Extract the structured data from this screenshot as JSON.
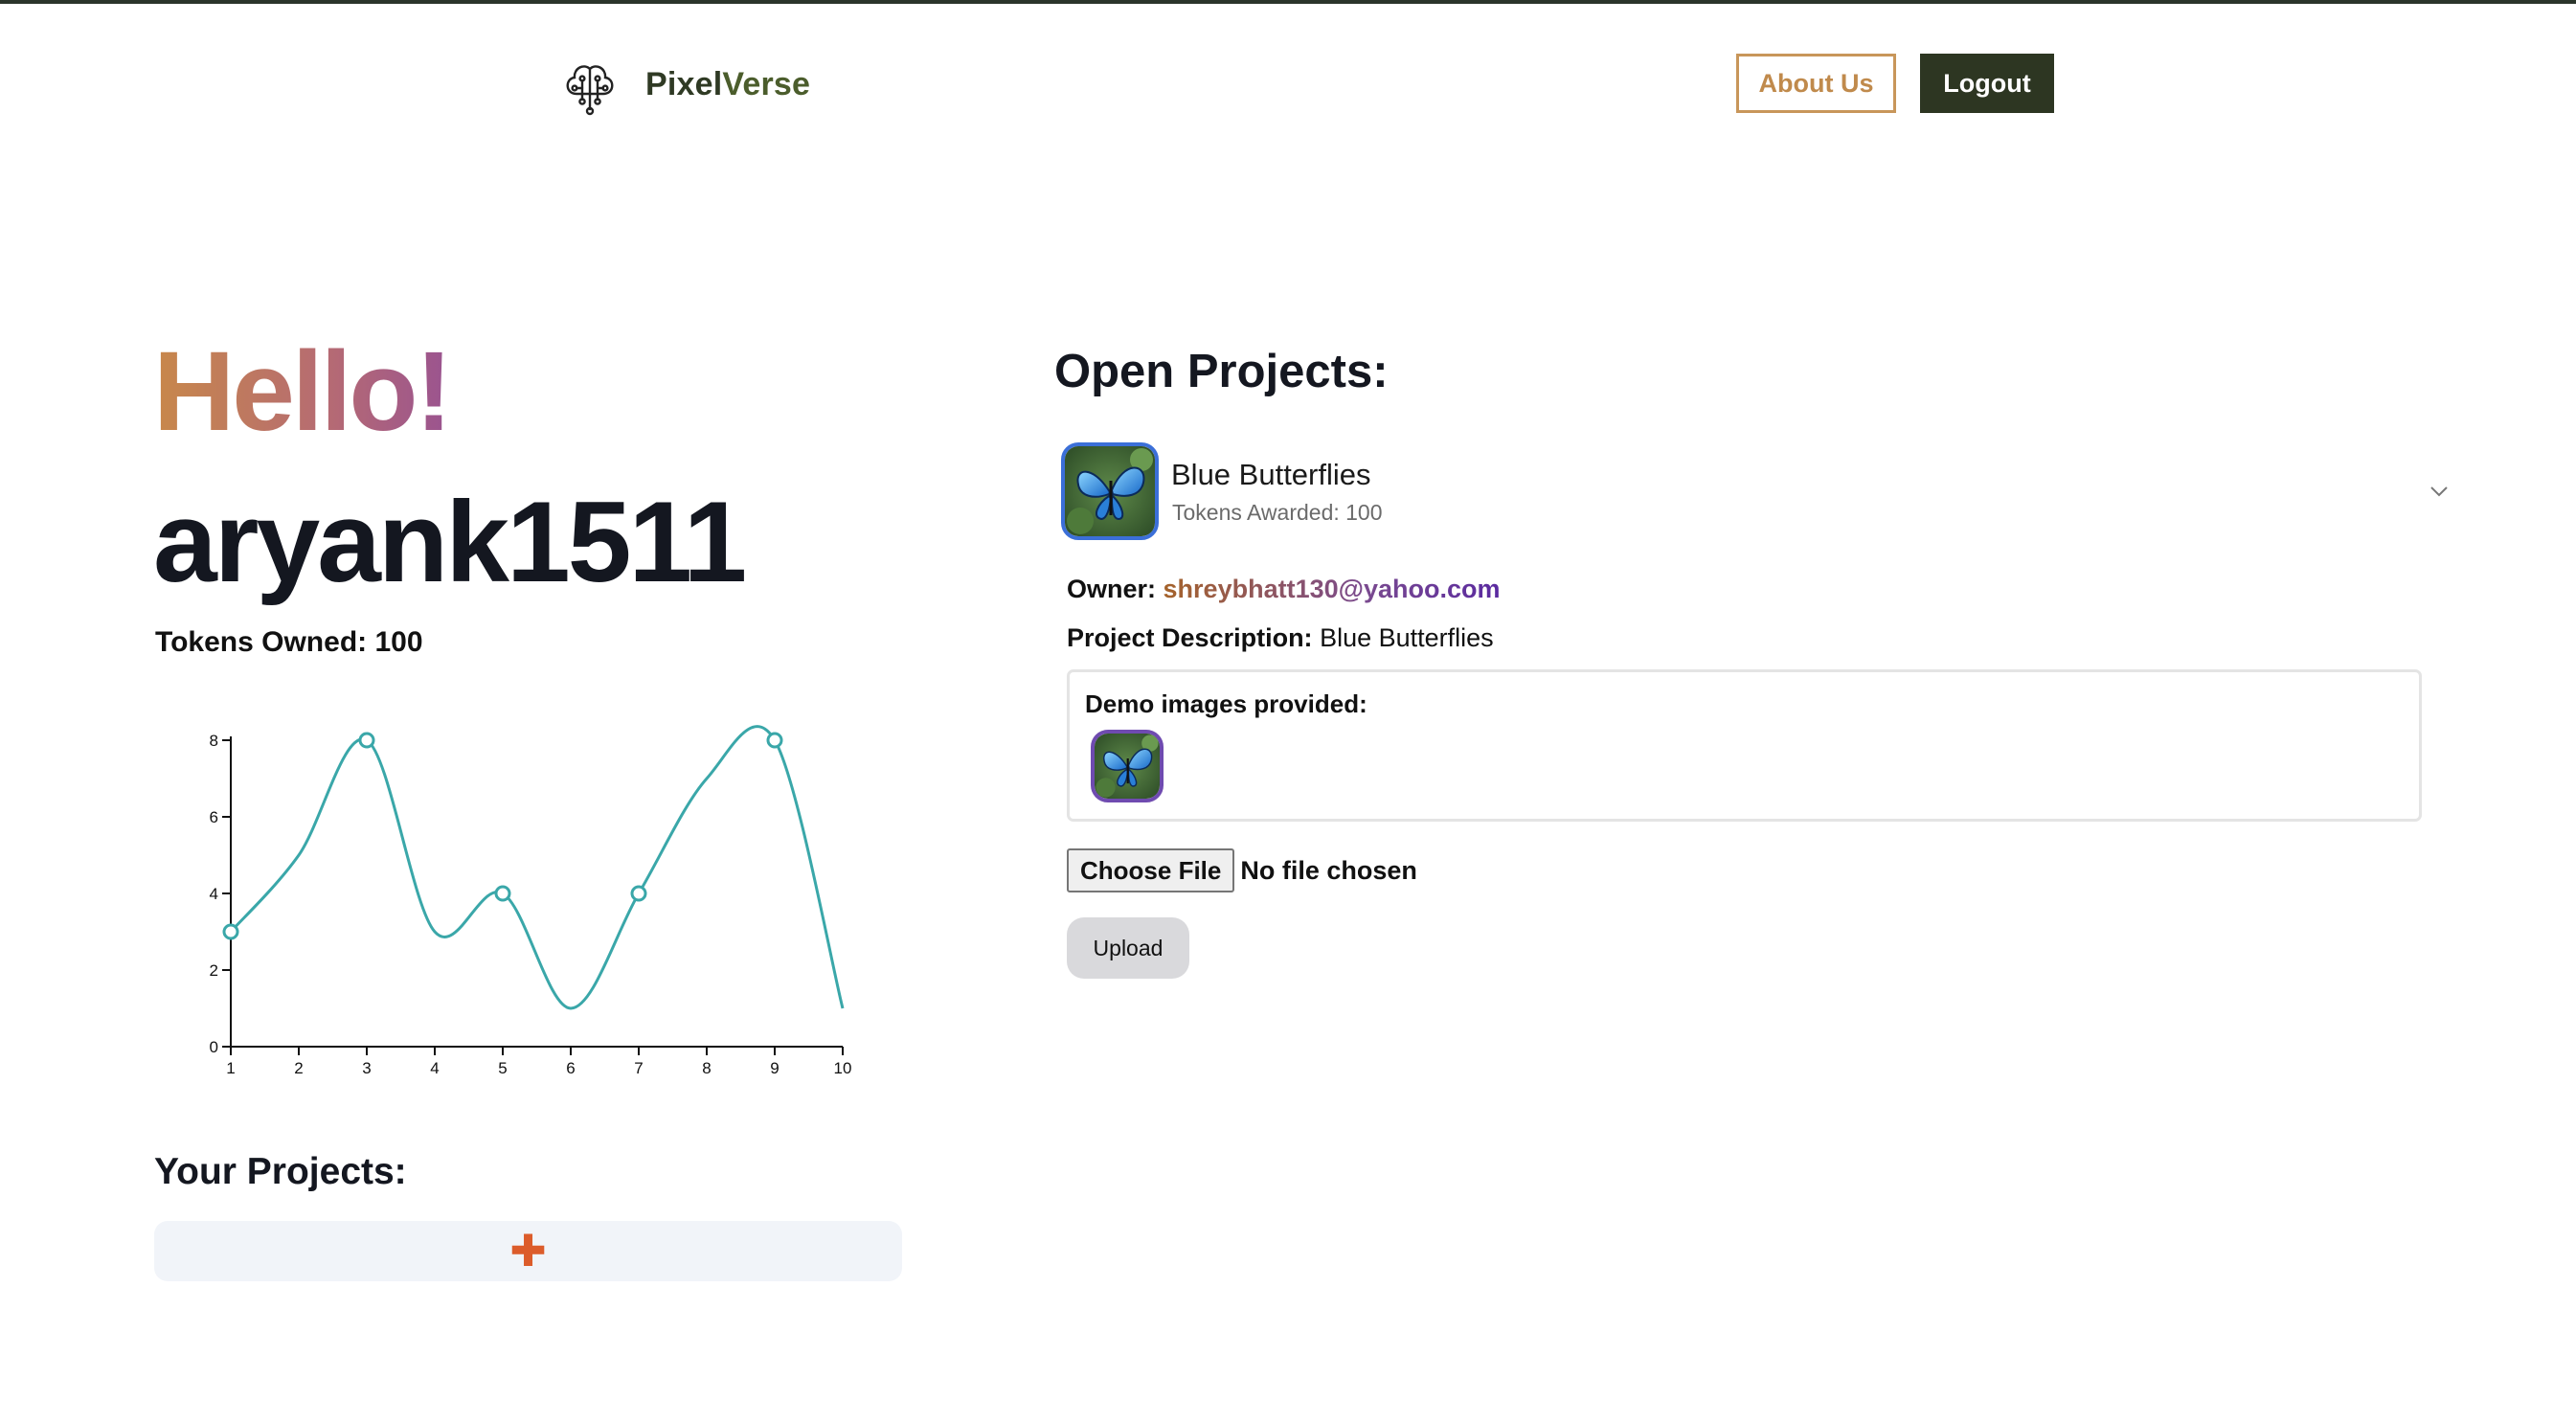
{
  "header": {
    "brand_part1": "Pixel",
    "brand_part2": "Verse",
    "logo_icon": "brain-circuit-icon",
    "about_label": "About Us",
    "logout_label": "Logout"
  },
  "profile": {
    "greeting": "Hello!",
    "username": "aryank1511",
    "tokens_owned": "Tokens Owned: 100"
  },
  "chart_data": {
    "type": "line",
    "x": [
      1,
      2,
      3,
      4,
      5,
      6,
      7,
      8,
      9,
      10
    ],
    "series": [
      {
        "values": [
          3,
          5,
          8,
          3,
          4,
          1,
          4,
          7,
          8,
          1
        ]
      }
    ],
    "marked_points": [
      1,
      3,
      5,
      7,
      9
    ],
    "xlim": [
      1,
      10
    ],
    "ylim": [
      0,
      8
    ],
    "y_ticks": [
      0,
      2,
      4,
      6,
      8
    ],
    "x_ticks": [
      1,
      2,
      3,
      4,
      5,
      6,
      7,
      8,
      9,
      10
    ],
    "line_color": "#3aa7a9",
    "curve": "smooth",
    "grid": false
  },
  "your_projects": {
    "title": "Your Projects:",
    "add_icon": "plus-icon",
    "add_symbol": "✚"
  },
  "open_projects": {
    "title": "Open Projects:",
    "project": {
      "name": "Blue Butterflies",
      "tokens": "Tokens Awarded: 100",
      "owner_label": "Owner:",
      "owner_email": "shreybhatt130@yahoo.com",
      "desc_label": "Project Description:",
      "desc_value": "Blue Butterflies",
      "demo_label": "Demo images provided:",
      "thumb_icon": "butterfly-image",
      "expand_icon": "chevron-down-icon"
    },
    "file_input": {
      "button": "Choose File",
      "status": "No file chosen"
    },
    "upload_label": "Upload"
  },
  "colors": {
    "brand_dark": "#2d3622",
    "about_accent": "#c8965a",
    "plus": "#dc5c2b",
    "thumb_border": "#3b6fd8",
    "demo_border": "#6f4bb0"
  }
}
